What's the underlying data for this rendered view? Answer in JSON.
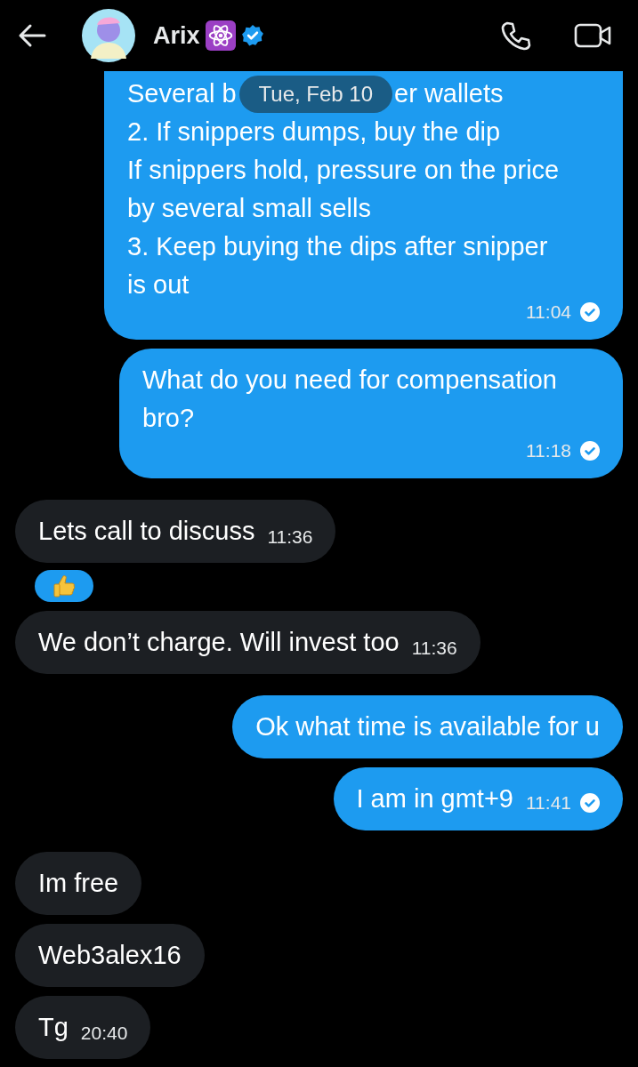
{
  "header": {
    "name": "Arix",
    "verified": true
  },
  "date_chip": "Tue, Feb 10",
  "messages": [
    {
      "kind": "sent",
      "text_before_chip": "Several b",
      "text_after_chip": "er wallets",
      "text": "2. If snippers dumps, buy the dip\nIf snippers hold, pressure on the price\nby several small sells\n3. Keep buying the dips after snipper\nis out",
      "time": "11:04",
      "read": true,
      "clipped_top": true
    },
    {
      "kind": "sent",
      "text": "What do you need for compensation bro?",
      "time": "11:18",
      "read": true
    },
    {
      "kind": "received",
      "text": "Lets call to discuss",
      "time": "11:36",
      "reaction": {
        "kind": "thumbs-up"
      }
    },
    {
      "kind": "received",
      "text": "We don’t charge. Will invest too",
      "time": "11:36"
    },
    {
      "kind": "sent",
      "text": "Ok what time is available for u"
    },
    {
      "kind": "sent",
      "text": "I am in gmt+9",
      "time": "11:41",
      "read": true
    },
    {
      "kind": "received",
      "text": "Im free"
    },
    {
      "kind": "received",
      "text": "Web3alex16"
    },
    {
      "kind": "received",
      "text": "Tg",
      "time": "20:40"
    }
  ]
}
